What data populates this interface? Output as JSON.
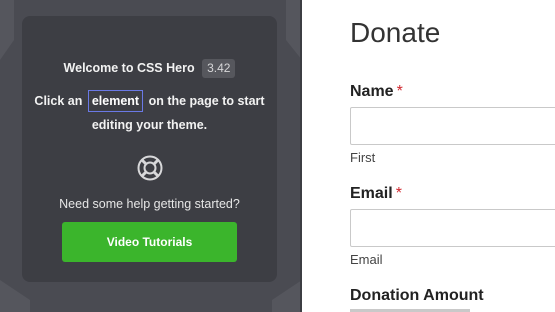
{
  "sidebar": {
    "welcome_title": "Welcome to CSS Hero",
    "version": "3.42",
    "instruction_prefix": "Click an",
    "instruction_chip": "element",
    "instruction_suffix": "on the page to start editing your theme.",
    "help_icon": "lifebuoy-icon",
    "help_text": "Need some help getting started?",
    "video_button_label": "Video Tutorials",
    "button_color": "#3bb52c"
  },
  "form": {
    "title": "Donate",
    "name_label": "Name",
    "name_required_mark": "*",
    "name_sublabel": "First",
    "email_label": "Email",
    "email_required_mark": "*",
    "email_sublabel": "Email",
    "amount_label": "Donation Amount"
  }
}
